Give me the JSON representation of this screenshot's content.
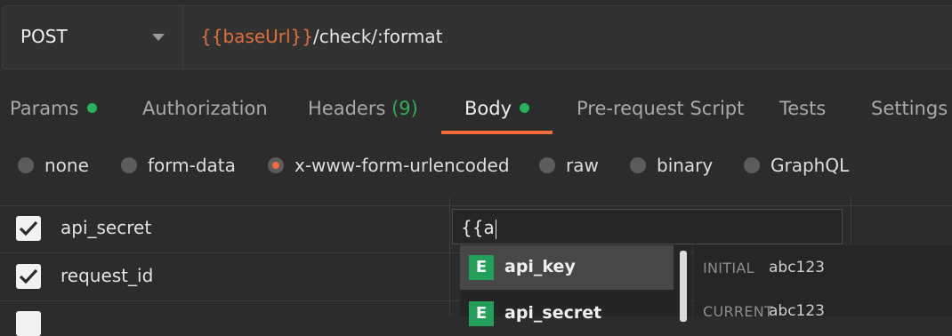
{
  "request": {
    "method": "POST",
    "url_variable": "{{baseUrl}}",
    "url_path": "/check/:format"
  },
  "tabs": {
    "params": "Params",
    "authorization": "Authorization",
    "headers": "Headers",
    "headers_count": "(9)",
    "body": "Body",
    "prerequest": "Pre-request Script",
    "tests": "Tests",
    "settings": "Settings"
  },
  "body_modes": {
    "none": "none",
    "form_data": "form-data",
    "urlencoded": "x-www-form-urlencoded",
    "raw": "raw",
    "binary": "binary",
    "graphql": "GraphQL"
  },
  "rows": [
    {
      "key": "api_secret",
      "value": "{{a"
    },
    {
      "key": "request_id"
    }
  ],
  "autocomplete": {
    "items": [
      {
        "badge": "E",
        "name": "api_key"
      },
      {
        "badge": "E",
        "name": "api_secret"
      }
    ],
    "preview": {
      "initial_label": "INITIAL",
      "initial_value": "abc123",
      "current_label": "CURRENT",
      "current_value": "abc123"
    }
  },
  "colors": {
    "accent": "#f26b3a",
    "variable": "#e0703a",
    "status_dot": "#26b35a",
    "env_badge": "#22a05a"
  }
}
